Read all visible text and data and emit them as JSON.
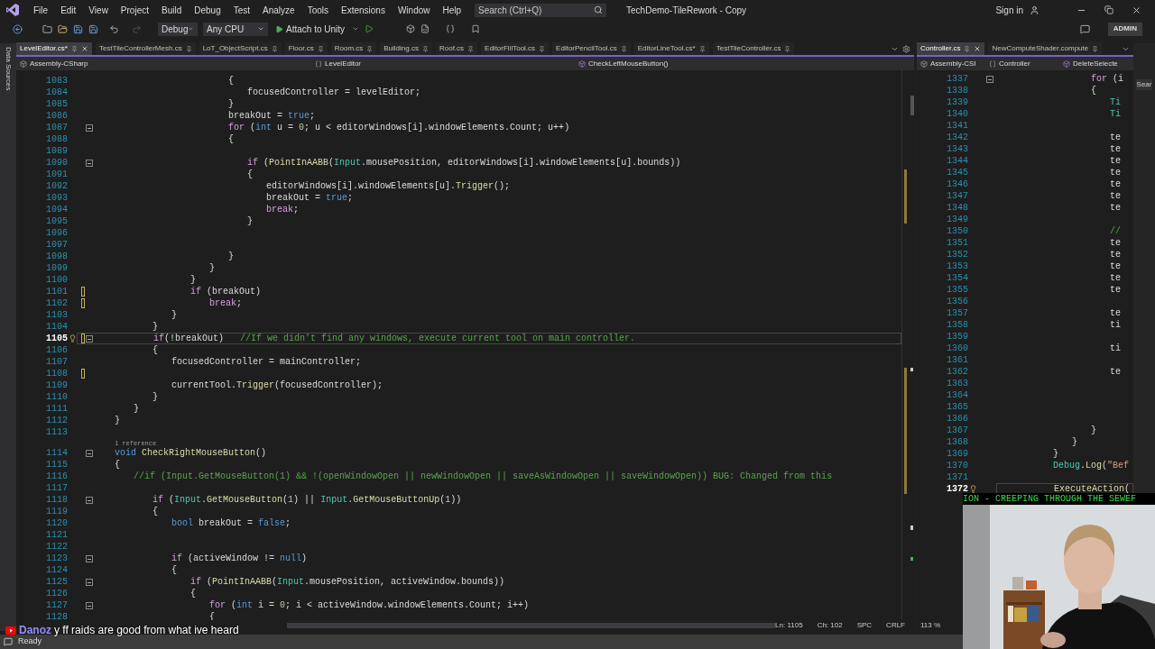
{
  "menu_bar": {
    "items": [
      "File",
      "Edit",
      "View",
      "Project",
      "Build",
      "Debug",
      "Test",
      "Analyze",
      "Tools",
      "Extensions",
      "Window",
      "Help"
    ],
    "search": {
      "placeholder": "Search (Ctrl+Q)"
    },
    "title": "TechDemo-TileRework - Copy",
    "sign_in": "Sign in"
  },
  "toolbar": {
    "configuration": "Debug",
    "platform": "Any CPU",
    "run_button": "Attach to Unity",
    "badge": "ADMIN"
  },
  "side_strip": {
    "label": "Data Sources"
  },
  "main_editor": {
    "tabs": [
      {
        "label": "LevelEditor.cs*",
        "selected": true
      },
      {
        "label": "TestTileControllerMesh.cs",
        "selected": false
      },
      {
        "label": "LoT_ObjectScript.cs",
        "selected": false
      },
      {
        "label": "Floor.cs",
        "selected": false
      },
      {
        "label": "Room.cs",
        "selected": false
      },
      {
        "label": "Building.cs",
        "selected": false
      },
      {
        "label": "Roof.cs",
        "selected": false
      },
      {
        "label": "EditorFillTool.cs",
        "selected": false
      },
      {
        "label": "EditorPencilTool.cs",
        "selected": false
      },
      {
        "label": "EditorLineTool.cs*",
        "selected": false
      },
      {
        "label": "TestTileController.cs",
        "selected": false
      }
    ],
    "nav": {
      "project": "Assembly-CSharp",
      "class": "LevelEditor",
      "member": "CheckLeftMouseButton()"
    },
    "lines": [
      {
        "number": "1083",
        "tokens": [
          {
            "kind": "plain",
            "text": "\t\t\t\t\t\t\t\t{"
          }
        ],
        "selected": false,
        "changed": false,
        "foldable": false
      },
      {
        "number": "1084",
        "tokens": [
          {
            "kind": "plain",
            "text": "\t\t\t\t\t\t\t\t\tfocusedController = levelEditor;"
          }
        ],
        "selected": false,
        "changed": false,
        "foldable": false
      },
      {
        "number": "1085",
        "tokens": [
          {
            "kind": "plain",
            "text": "\t\t\t\t\t\t\t\t}"
          }
        ],
        "selected": false,
        "changed": false,
        "foldable": false
      },
      {
        "number": "1086",
        "tokens": [
          {
            "kind": "plain",
            "text": "\t\t\t\t\t\t\t\tbreakOut = "
          },
          {
            "kind": "keyword",
            "text": "true"
          },
          {
            "kind": "plain",
            "text": ";"
          }
        ],
        "selected": false,
        "changed": false,
        "foldable": false
      },
      {
        "number": "1087",
        "tokens": [
          {
            "kind": "control",
            "text": "\t\t\t\t\t\t\t\tfor"
          },
          {
            "kind": "plain",
            "text": " ("
          },
          {
            "kind": "keyword",
            "text": "int"
          },
          {
            "kind": "plain",
            "text": " u = "
          },
          {
            "kind": "number",
            "text": "0"
          },
          {
            "kind": "plain",
            "text": "; u < editorWindows[i].windowElements.Count; u++)"
          }
        ],
        "selected": false,
        "changed": false,
        "foldable": true
      },
      {
        "number": "1088",
        "tokens": [
          {
            "kind": "plain",
            "text": "\t\t\t\t\t\t\t\t{"
          }
        ],
        "selected": false,
        "changed": false,
        "foldable": false
      },
      {
        "number": "1089",
        "selected": false,
        "changed": false,
        "foldable": false
      },
      {
        "number": "1090",
        "tokens": [
          {
            "kind": "control",
            "text": "\t\t\t\t\t\t\t\t\tif"
          },
          {
            "kind": "plain",
            "text": " ("
          },
          {
            "kind": "method",
            "text": "PointInAABB"
          },
          {
            "kind": "plain",
            "text": "("
          },
          {
            "kind": "type",
            "text": "Input"
          },
          {
            "kind": "plain",
            "text": ".mousePosition, editorWindows[i].windowElements[u].bounds))"
          }
        ],
        "selected": false,
        "changed": false,
        "foldable": true
      },
      {
        "number": "1091",
        "tokens": [
          {
            "kind": "plain",
            "text": "\t\t\t\t\t\t\t\t\t{"
          }
        ],
        "selected": false,
        "changed": false,
        "foldable": false
      },
      {
        "number": "1092",
        "tokens": [
          {
            "kind": "plain",
            "text": "\t\t\t\t\t\t\t\t\t\teditorWindows[i].windowElements[u]."
          },
          {
            "kind": "method",
            "text": "Trigger"
          },
          {
            "kind": "plain",
            "text": "();"
          }
        ],
        "selected": false,
        "changed": false,
        "foldable": false
      },
      {
        "number": "1093",
        "tokens": [
          {
            "kind": "plain",
            "text": "\t\t\t\t\t\t\t\t\t\tbreakOut = "
          },
          {
            "kind": "keyword",
            "text": "true"
          },
          {
            "kind": "plain",
            "text": ";"
          }
        ],
        "selected": false,
        "changed": false,
        "foldable": false
      },
      {
        "number": "1094",
        "tokens": [
          {
            "kind": "control",
            "text": "\t\t\t\t\t\t\t\t\t\tbreak"
          },
          {
            "kind": "plain",
            "text": ";"
          }
        ],
        "selected": false,
        "changed": false,
        "foldable": false
      },
      {
        "number": "1095",
        "tokens": [
          {
            "kind": "plain",
            "text": "\t\t\t\t\t\t\t\t\t}"
          }
        ],
        "selected": false,
        "changed": false,
        "foldable": false
      },
      {
        "number": "1096",
        "selected": false,
        "changed": false,
        "foldable": false
      },
      {
        "number": "1097",
        "selected": false,
        "changed": false,
        "foldable": false
      },
      {
        "number": "1098",
        "tokens": [
          {
            "kind": "plain",
            "text": "\t\t\t\t\t\t\t\t}"
          }
        ],
        "selected": false,
        "changed": false,
        "foldable": false
      },
      {
        "number": "1099",
        "tokens": [
          {
            "kind": "plain",
            "text": "\t\t\t\t\t\t\t}"
          }
        ],
        "selected": false,
        "changed": false,
        "foldable": false
      },
      {
        "number": "1100",
        "tokens": [
          {
            "kind": "plain",
            "text": "\t\t\t\t\t\t}"
          }
        ],
        "selected": false,
        "changed": false,
        "foldable": false
      },
      {
        "number": "1101",
        "tokens": [
          {
            "kind": "control",
            "text": "\t\t\t\t\t\tif"
          },
          {
            "kind": "plain",
            "text": " (breakOut)"
          }
        ],
        "selected": false,
        "changed": true,
        "foldable": false
      },
      {
        "number": "1102",
        "tokens": [
          {
            "kind": "control",
            "text": "\t\t\t\t\t\t\tbreak"
          },
          {
            "kind": "plain",
            "text": ";"
          }
        ],
        "selected": false,
        "changed": true,
        "foldable": false
      },
      {
        "number": "1103",
        "tokens": [
          {
            "kind": "plain",
            "text": "\t\t\t\t\t}"
          }
        ],
        "selected": false,
        "changed": false,
        "foldable": false
      },
      {
        "number": "1104",
        "tokens": [
          {
            "kind": "plain",
            "text": "\t\t\t\t}"
          }
        ],
        "selected": false,
        "changed": false,
        "foldable": false
      },
      {
        "number": "1105",
        "tokens": [
          {
            "kind": "control",
            "text": "\t\t\t\tif"
          },
          {
            "kind": "plain",
            "text": "(!breakOut)   "
          },
          {
            "kind": "comment",
            "text": "//If we didn't find any windows, execute current tool on main controller."
          }
        ],
        "selected": true,
        "changed": true,
        "foldable": true
      },
      {
        "number": "1106",
        "tokens": [
          {
            "kind": "plain",
            "text": "\t\t\t\t{"
          }
        ],
        "selected": false,
        "changed": false,
        "foldable": false
      },
      {
        "number": "1107",
        "tokens": [
          {
            "kind": "plain",
            "text": "\t\t\t\t\tfocusedController = mainController;"
          }
        ],
        "selected": false,
        "changed": false,
        "foldable": false
      },
      {
        "number": "1108",
        "selected": false,
        "changed": true,
        "foldable": false
      },
      {
        "number": "1109",
        "tokens": [
          {
            "kind": "plain",
            "text": "\t\t\t\t\tcurrentTool."
          },
          {
            "kind": "method",
            "text": "Trigger"
          },
          {
            "kind": "plain",
            "text": "(focusedController);"
          }
        ],
        "selected": false,
        "changed": false,
        "foldable": false
      },
      {
        "number": "1110",
        "tokens": [
          {
            "kind": "plain",
            "text": "\t\t\t\t}"
          }
        ],
        "selected": false,
        "changed": false,
        "foldable": false
      },
      {
        "number": "1111",
        "tokens": [
          {
            "kind": "plain",
            "text": "\t\t\t}"
          }
        ],
        "selected": false,
        "changed": false,
        "foldable": false
      },
      {
        "number": "1112",
        "tokens": [
          {
            "kind": "plain",
            "text": "\t\t}"
          }
        ],
        "selected": false,
        "changed": false,
        "foldable": false
      },
      {
        "number": "1113",
        "selected": false,
        "changed": false,
        "foldable": false
      },
      {
        "number": "1114",
        "lens": "1 reference",
        "tokens": [
          {
            "kind": "keyword",
            "text": "\t\tvoid "
          },
          {
            "kind": "method",
            "text": "CheckRightMouseButton"
          },
          {
            "kind": "plain",
            "text": "()"
          }
        ],
        "selected": false,
        "changed": false,
        "foldable": true
      },
      {
        "number": "1115",
        "tokens": [
          {
            "kind": "plain",
            "text": "\t\t{"
          }
        ],
        "selected": false,
        "changed": false,
        "foldable": false
      },
      {
        "number": "1116",
        "tokens": [
          {
            "kind": "comment",
            "text": "\t\t\t//if (Input.GetMouseButton(1) && !(openWindowOpen || newWindowOpen || saveAsWindowOpen || saveWindowOpen)) BUG: Changed from this"
          }
        ],
        "selected": false,
        "changed": false,
        "foldable": false
      },
      {
        "number": "1117",
        "selected": false,
        "changed": false,
        "foldable": false
      },
      {
        "number": "1118",
        "tokens": [
          {
            "kind": "control",
            "text": "\t\t\t\tif"
          },
          {
            "kind": "plain",
            "text": " ("
          },
          {
            "kind": "type",
            "text": "Input"
          },
          {
            "kind": "plain",
            "text": "."
          },
          {
            "kind": "method",
            "text": "GetMouseButton"
          },
          {
            "kind": "plain",
            "text": "("
          },
          {
            "kind": "number",
            "text": "1"
          },
          {
            "kind": "plain",
            "text": ") || "
          },
          {
            "kind": "type",
            "text": "Input"
          },
          {
            "kind": "plain",
            "text": "."
          },
          {
            "kind": "method",
            "text": "GetMouseButtonUp"
          },
          {
            "kind": "plain",
            "text": "("
          },
          {
            "kind": "number",
            "text": "1"
          },
          {
            "kind": "plain",
            "text": "))"
          }
        ],
        "selected": false,
        "changed": false,
        "foldable": true
      },
      {
        "number": "1119",
        "tokens": [
          {
            "kind": "plain",
            "text": "\t\t\t\t{"
          }
        ],
        "selected": false,
        "changed": false,
        "foldable": false
      },
      {
        "number": "1120",
        "tokens": [
          {
            "kind": "keyword",
            "text": "\t\t\t\t\tbool"
          },
          {
            "kind": "plain",
            "text": " breakOut = "
          },
          {
            "kind": "keyword",
            "text": "false"
          },
          {
            "kind": "plain",
            "text": ";"
          }
        ],
        "selected": false,
        "changed": false,
        "foldable": false
      },
      {
        "number": "1121",
        "selected": false,
        "changed": false,
        "foldable": false
      },
      {
        "number": "1122",
        "selected": false,
        "changed": false,
        "foldable": false
      },
      {
        "number": "1123",
        "tokens": [
          {
            "kind": "control",
            "text": "\t\t\t\t\tif"
          },
          {
            "kind": "plain",
            "text": " (activeWindow != "
          },
          {
            "kind": "keyword",
            "text": "null"
          },
          {
            "kind": "plain",
            "text": ")"
          }
        ],
        "selected": false,
        "changed": false,
        "foldable": true
      },
      {
        "number": "1124",
        "tokens": [
          {
            "kind": "plain",
            "text": "\t\t\t\t\t{"
          }
        ],
        "selected": false,
        "changed": false,
        "foldable": false
      },
      {
        "number": "1125",
        "tokens": [
          {
            "kind": "control",
            "text": "\t\t\t\t\t\tif"
          },
          {
            "kind": "plain",
            "text": " ("
          },
          {
            "kind": "method",
            "text": "PointInAABB"
          },
          {
            "kind": "plain",
            "text": "("
          },
          {
            "kind": "type",
            "text": "Input"
          },
          {
            "kind": "plain",
            "text": ".mousePosition, activeWindow.bounds))"
          }
        ],
        "selected": false,
        "changed": false,
        "foldable": true
      },
      {
        "number": "1126",
        "tokens": [
          {
            "kind": "plain",
            "text": "\t\t\t\t\t\t{"
          }
        ],
        "selected": false,
        "changed": false,
        "foldable": false
      },
      {
        "number": "1127",
        "tokens": [
          {
            "kind": "control",
            "text": "\t\t\t\t\t\t\tfor"
          },
          {
            "kind": "plain",
            "text": " ("
          },
          {
            "kind": "keyword",
            "text": "int"
          },
          {
            "kind": "plain",
            "text": " i = "
          },
          {
            "kind": "number",
            "text": "0"
          },
          {
            "kind": "plain",
            "text": "; i < activeWindow.windowElements.Count; i++)"
          }
        ],
        "selected": false,
        "changed": false,
        "foldable": true
      },
      {
        "number": "1128",
        "tokens": [
          {
            "kind": "plain",
            "text": "\t\t\t\t\t\t\t{"
          }
        ],
        "selected": false,
        "changed": false,
        "foldable": false
      }
    ],
    "status": {
      "line": "Ln: 1105",
      "column": "Ch: 102",
      "indent": "SPC",
      "line_ending": "CRLF"
    }
  },
  "side_editor": {
    "tabs": [
      {
        "label": "Controller.cs",
        "selected": true
      },
      {
        "label": "NewComputeShader.compute",
        "selected": false
      }
    ],
    "nav": {
      "project": "Assembly-CSI",
      "class": "Controller",
      "member": "DeleteSelecte"
    },
    "lines": [
      {
        "number": "1337",
        "tokens": [
          {
            "kind": "control",
            "text": "\t\t\t\t\tfor"
          },
          {
            "kind": "plain",
            "text": " (i"
          }
        ],
        "selected": false,
        "foldable": true
      },
      {
        "number": "1338",
        "tokens": [
          {
            "kind": "plain",
            "text": "\t\t\t\t\t{"
          }
        ],
        "selected": false,
        "foldable": false
      },
      {
        "number": "1339",
        "tokens": [
          {
            "kind": "type",
            "text": "\t\t\t\t\t\tTi"
          }
        ],
        "selected": false,
        "foldable": false
      },
      {
        "number": "1340",
        "tokens": [
          {
            "kind": "type",
            "text": "\t\t\t\t\t\tTi"
          }
        ],
        "selected": false,
        "foldable": false
      },
      {
        "number": "1341",
        "selected": false,
        "foldable": false
      },
      {
        "number": "1342",
        "tokens": [
          {
            "kind": "plain",
            "text": "\t\t\t\t\t\tte"
          }
        ],
        "selected": false,
        "foldable": false
      },
      {
        "number": "1343",
        "tokens": [
          {
            "kind": "plain",
            "text": "\t\t\t\t\t\tte"
          }
        ],
        "selected": false,
        "foldable": false
      },
      {
        "number": "1344",
        "tokens": [
          {
            "kind": "plain",
            "text": "\t\t\t\t\t\tte"
          }
        ],
        "selected": false,
        "foldable": false
      },
      {
        "number": "1345",
        "tokens": [
          {
            "kind": "plain",
            "text": "\t\t\t\t\t\tte"
          }
        ],
        "selected": false,
        "foldable": false
      },
      {
        "number": "1346",
        "tokens": [
          {
            "kind": "plain",
            "text": "\t\t\t\t\t\tte"
          }
        ],
        "selected": false,
        "foldable": false
      },
      {
        "number": "1347",
        "tokens": [
          {
            "kind": "plain",
            "text": "\t\t\t\t\t\tte"
          }
        ],
        "selected": false,
        "foldable": false
      },
      {
        "number": "1348",
        "tokens": [
          {
            "kind": "plain",
            "text": "\t\t\t\t\t\tte"
          }
        ],
        "selected": false,
        "foldable": false
      },
      {
        "number": "1349",
        "selected": false,
        "foldable": false
      },
      {
        "number": "1350",
        "tokens": [
          {
            "kind": "comment",
            "text": "\t\t\t\t\t\t//"
          }
        ],
        "selected": false,
        "foldable": false
      },
      {
        "number": "1351",
        "tokens": [
          {
            "kind": "plain",
            "text": "\t\t\t\t\t\tte"
          }
        ],
        "selected": false,
        "foldable": false
      },
      {
        "number": "1352",
        "tokens": [
          {
            "kind": "plain",
            "text": "\t\t\t\t\t\tte"
          }
        ],
        "selected": false,
        "foldable": false
      },
      {
        "number": "1353",
        "tokens": [
          {
            "kind": "plain",
            "text": "\t\t\t\t\t\tte"
          }
        ],
        "selected": false,
        "foldable": false
      },
      {
        "number": "1354",
        "tokens": [
          {
            "kind": "plain",
            "text": "\t\t\t\t\t\tte"
          }
        ],
        "selected": false,
        "foldable": false
      },
      {
        "number": "1355",
        "tokens": [
          {
            "kind": "plain",
            "text": "\t\t\t\t\t\tte"
          }
        ],
        "selected": false,
        "foldable": false
      },
      {
        "number": "1356",
        "selected": false,
        "foldable": false
      },
      {
        "number": "1357",
        "tokens": [
          {
            "kind": "plain",
            "text": "\t\t\t\t\t\tte"
          }
        ],
        "selected": false,
        "foldable": false
      },
      {
        "number": "1358",
        "tokens": [
          {
            "kind": "plain",
            "text": "\t\t\t\t\t\tti"
          }
        ],
        "selected": false,
        "foldable": false
      },
      {
        "number": "1359",
        "selected": false,
        "foldable": false
      },
      {
        "number": "1360",
        "tokens": [
          {
            "kind": "plain",
            "text": "\t\t\t\t\t\tti"
          }
        ],
        "selected": false,
        "foldable": false
      },
      {
        "number": "1361",
        "selected": false,
        "foldable": false
      },
      {
        "number": "1362",
        "tokens": [
          {
            "kind": "plain",
            "text": "\t\t\t\t\t\tte"
          }
        ],
        "selected": false,
        "foldable": false
      },
      {
        "number": "1363",
        "selected": false,
        "foldable": false
      },
      {
        "number": "1364",
        "selected": false,
        "foldable": false
      },
      {
        "number": "1365",
        "selected": false,
        "foldable": false
      },
      {
        "number": "1366",
        "selected": false,
        "foldable": false
      },
      {
        "number": "1367",
        "tokens": [
          {
            "kind": "plain",
            "text": "\t\t\t\t\t}"
          }
        ],
        "selected": false,
        "foldable": false
      },
      {
        "number": "1368",
        "tokens": [
          {
            "kind": "plain",
            "text": "\t\t\t\t}"
          }
        ],
        "selected": false,
        "foldable": false
      },
      {
        "number": "1369",
        "tokens": [
          {
            "kind": "plain",
            "text": "\t\t\t}"
          }
        ],
        "selected": false,
        "foldable": false
      },
      {
        "number": "1370",
        "tokens": [
          {
            "kind": "type",
            "text": "\t\t\tDebug"
          },
          {
            "kind": "plain",
            "text": "."
          },
          {
            "kind": "method",
            "text": "Log"
          },
          {
            "kind": "plain",
            "text": "("
          },
          {
            "kind": "string",
            "text": "\"Bef"
          }
        ],
        "selected": false,
        "foldable": false
      },
      {
        "number": "1371",
        "selected": false,
        "foldable": false
      },
      {
        "number": "1372",
        "tokens": [
          {
            "kind": "method",
            "text": "\t\t\tExecuteAction"
          },
          {
            "kind": "plain",
            "text": "("
          }
        ],
        "selected": true,
        "foldable": false
      }
    ],
    "status": {
      "zoom": "113 %"
    }
  },
  "right_strip": {
    "search": "Sear"
  },
  "status_bar": {
    "text": "Ready"
  },
  "stream_overlay": {
    "chat": {
      "user": "Danoz",
      "message": "y ff raids are good from what ive heard"
    },
    "banner": "ION - CREEPING THROUGH THE SEWEF"
  }
}
